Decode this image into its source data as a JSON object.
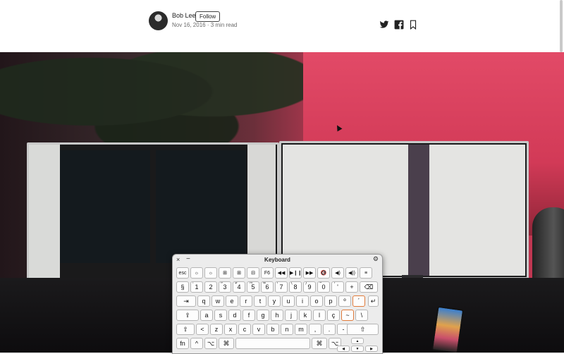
{
  "article": {
    "author": "Bob Lee",
    "follow_label": "Follow",
    "meta": "Nov 16, 2016 · 3 min read"
  },
  "share": {
    "twitter_icon": "twitter-icon",
    "facebook_icon": "facebook-icon",
    "bookmark_icon": "bookmark-icon"
  },
  "keyboard": {
    "title": "Keyboard",
    "close": "×",
    "minimize": "−",
    "settings": "⚙",
    "row0": [
      "esc",
      "☼",
      "☼",
      "⊞",
      "⊞",
      "⊟",
      "F6",
      "◀◀",
      "▶❙❙",
      "▶▶",
      "🔇",
      "◀)",
      "◀))",
      "≡"
    ],
    "row1": [
      {
        "main": "§",
        "sup": "°"
      },
      {
        "main": "1",
        "sup": "!"
      },
      {
        "main": "2",
        "sup": "\""
      },
      {
        "main": "3",
        "sup": "#"
      },
      {
        "main": "4",
        "sup": "$"
      },
      {
        "main": "5",
        "sup": "%"
      },
      {
        "main": "6",
        "sup": "&"
      },
      {
        "main": "7",
        "sup": "/"
      },
      {
        "main": "8",
        "sup": "("
      },
      {
        "main": "9",
        "sup": ")"
      },
      {
        "main": "0",
        "sup": "="
      },
      {
        "main": "'",
        "sup": "?"
      },
      {
        "main": "+",
        "sup": "*"
      },
      {
        "main": "⌫",
        "sup": ""
      }
    ],
    "row2": [
      "⇥",
      "q",
      "w",
      "e",
      "r",
      "t",
      "y",
      "u",
      "i",
      "o",
      "p",
      "º",
      "´"
    ],
    "row3": [
      "⇪",
      "a",
      "s",
      "d",
      "f",
      "g",
      "h",
      "j",
      "k",
      "l",
      "ç",
      "~",
      "\\"
    ],
    "row4": [
      "⇧",
      "<",
      "z",
      "x",
      "c",
      "v",
      "b",
      "n",
      "m",
      ",",
      ".",
      "-",
      "⇧"
    ],
    "row5": [
      "fn",
      "^",
      "⌥",
      "⌘",
      "",
      "⌘",
      "⌥"
    ],
    "return": "↵",
    "arrows": [
      "▲",
      "◀",
      "▼",
      "▶"
    ]
  },
  "colors": {
    "accent_highlight": "#e07a3a",
    "hero_red": "#d63c5b"
  }
}
